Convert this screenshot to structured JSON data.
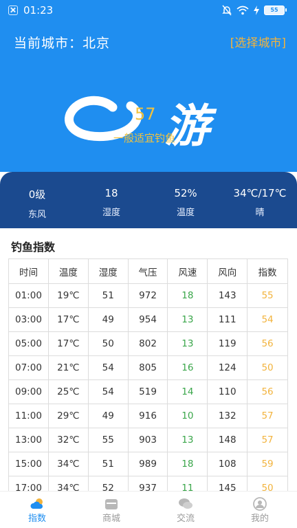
{
  "status_bar": {
    "time": "01:23",
    "battery": "55"
  },
  "header": {
    "city_label": "当前城市：北京",
    "select_city": "[选择城市]"
  },
  "logo": {
    "wordmark": "游",
    "score": "57",
    "subtitle": "一般适宜钓鱼"
  },
  "weather": [
    {
      "top": "0级",
      "bottom": "东风"
    },
    {
      "top": "18",
      "bottom": "湿度"
    },
    {
      "top": "52%",
      "bottom": "温度"
    },
    {
      "top": "34℃/17℃",
      "bottom": "晴"
    }
  ],
  "section_title": "钓鱼指数",
  "table": {
    "headers": [
      "时间",
      "温度",
      "湿度",
      "气压",
      "风速",
      "风向",
      "指数"
    ],
    "rows": [
      [
        "01:00",
        "19℃",
        "51",
        "972",
        "18",
        "143",
        "55"
      ],
      [
        "03:00",
        "17℃",
        "49",
        "954",
        "13",
        "111",
        "54"
      ],
      [
        "05:00",
        "17℃",
        "50",
        "802",
        "13",
        "119",
        "56"
      ],
      [
        "07:00",
        "21℃",
        "54",
        "805",
        "16",
        "124",
        "50"
      ],
      [
        "09:00",
        "25℃",
        "54",
        "519",
        "14",
        "110",
        "56"
      ],
      [
        "11:00",
        "29℃",
        "49",
        "916",
        "10",
        "132",
        "57"
      ],
      [
        "13:00",
        "32℃",
        "55",
        "903",
        "13",
        "148",
        "57"
      ],
      [
        "15:00",
        "34℃",
        "51",
        "989",
        "18",
        "108",
        "59"
      ],
      [
        "17:00",
        "34℃",
        "52",
        "937",
        "11",
        "145",
        "50"
      ]
    ]
  },
  "nav": [
    {
      "label": "指数",
      "icon": "weather-icon"
    },
    {
      "label": "商城",
      "icon": "shop-icon"
    },
    {
      "label": "交流",
      "icon": "chat-icon"
    },
    {
      "label": "我的",
      "icon": "profile-icon"
    }
  ],
  "colors": {
    "primary": "#1f8ef0",
    "weather_bar": "#1b4a8f",
    "accent": "#f2b33d",
    "wind_speed": "#3aa64a"
  }
}
